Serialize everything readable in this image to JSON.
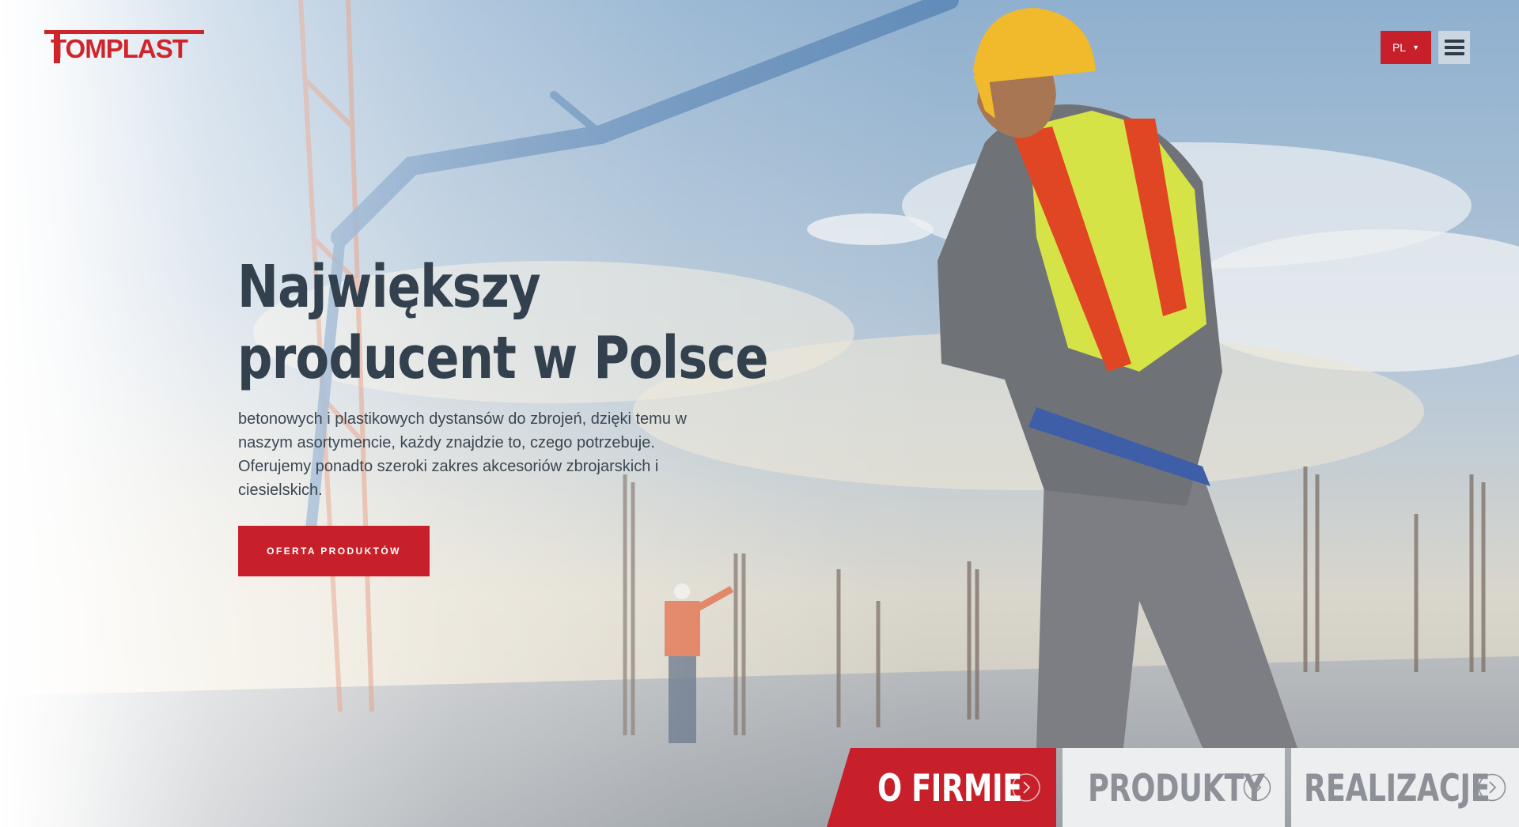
{
  "brand": {
    "logo_text": "TOMPLAST",
    "color": "#c8202a"
  },
  "header": {
    "language": "PL",
    "language_caret": "▼",
    "menu_icon": "hamburger-icon"
  },
  "hero": {
    "headline_line1": "Największy",
    "headline_line2": "producent w Polsce",
    "lead": "betonowych i plastikowych dystansów do zbrojeń, dzięki temu w naszym asortymencie, każdy znajdzie to, czego potrzebuje. Oferujemy ponadto szeroki zakres akcesoriów zbrojarskich i ciesielskich.",
    "cta_label": "OFERTA PRODUKTÓW"
  },
  "tabs": [
    {
      "label": "O FIRMIE",
      "icon": "chevron-right-icon",
      "active": true
    },
    {
      "label": "PRODUKTY",
      "icon": "chevron-right-icon",
      "active": false
    },
    {
      "label": "REALIZACJE",
      "icon": "chevron-right-icon",
      "active": false
    }
  ],
  "colors": {
    "accent": "#c8202a",
    "headline": "#33414f",
    "tab_inactive_bg": "#eceeef",
    "tab_inactive_text": "#8d9197"
  }
}
